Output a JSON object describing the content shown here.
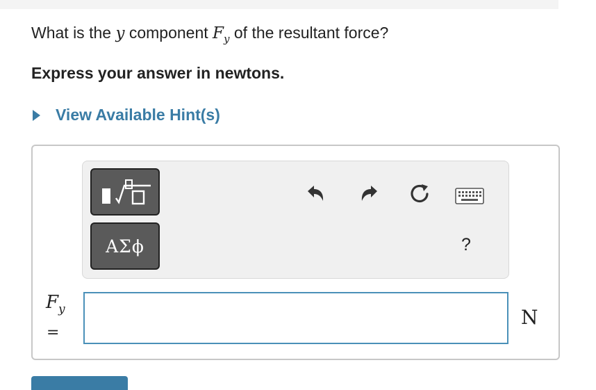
{
  "question": {
    "prefix": "What is the ",
    "var_y": "y",
    "middle": " component ",
    "symbol_main": "F",
    "symbol_sub": "y",
    "suffix": " of the resultant force?"
  },
  "instruction": "Express your answer in newtons.",
  "hint_link": "View Available Hint(s)",
  "toolbar": {
    "templates_icon": "templates-sqrt-icon",
    "symbols_label": "ΑΣϕ",
    "undo_icon": "undo-icon",
    "redo_icon": "redo-icon",
    "reset_icon": "reset-icon",
    "keyboard_icon": "keyboard-icon",
    "help_label": "?"
  },
  "answer": {
    "label_main": "F",
    "label_sub": "y",
    "equals": "=",
    "value": "",
    "placeholder": "",
    "unit": "N"
  },
  "colors": {
    "accent": "#3a7ca5",
    "input_border": "#4a90b8",
    "toolbar_bg": "#f0f0f0",
    "button_dark": "#5a5a5a"
  }
}
